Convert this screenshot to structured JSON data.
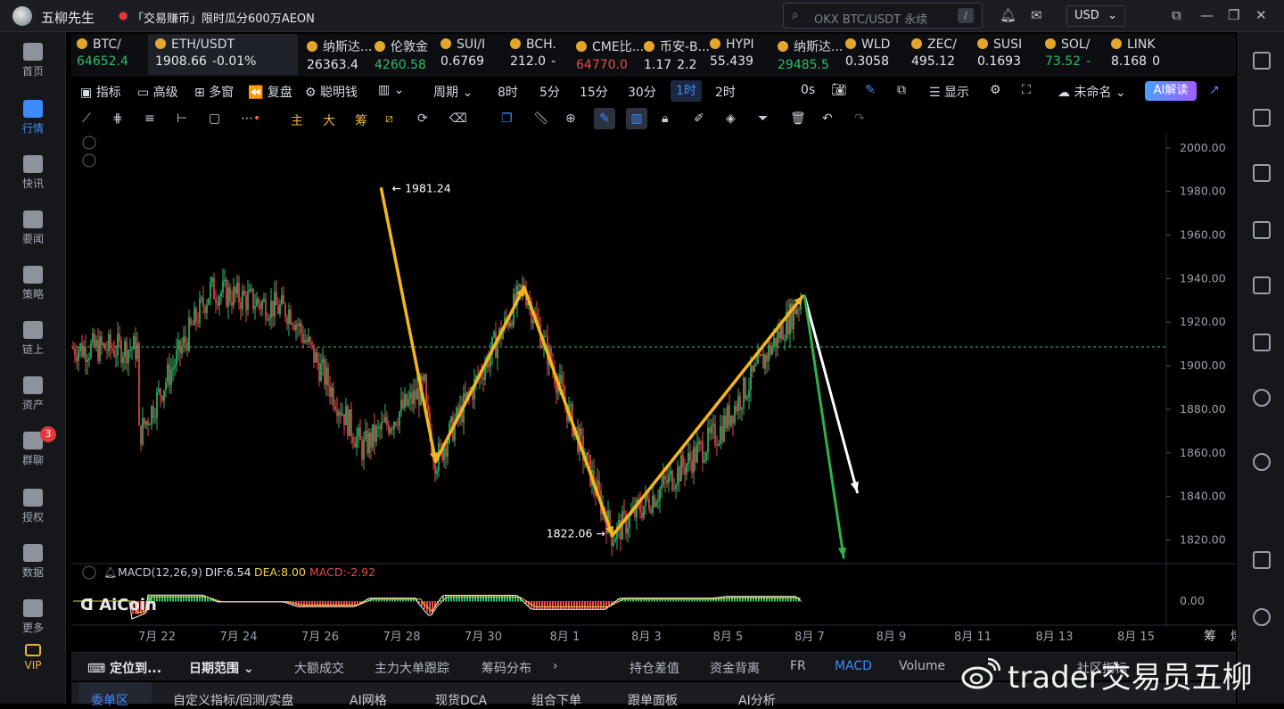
{
  "app": {
    "name": "五柳先生",
    "promo": "「交易赚币」限时瓜分600万AEON"
  },
  "search": {
    "placeholder": "OKX BTC/USDT 永续",
    "shortcut": "/"
  },
  "currency": "USD",
  "sidebar": [
    {
      "label": "首页",
      "icon": "home-icon"
    },
    {
      "label": "行情",
      "icon": "market-icon",
      "active": true
    },
    {
      "label": "快讯",
      "icon": "news-flash-icon"
    },
    {
      "label": "要闻",
      "icon": "headline-icon"
    },
    {
      "label": "策略",
      "icon": "strategy-icon"
    },
    {
      "label": "链上",
      "icon": "onchain-icon"
    },
    {
      "label": "资产",
      "icon": "wallet-icon"
    },
    {
      "label": "群聊",
      "icon": "chat-icon",
      "badge": "3"
    },
    {
      "label": "授权",
      "icon": "key-icon"
    },
    {
      "label": "数据",
      "icon": "data-icon"
    },
    {
      "label": "更多",
      "icon": "more-icon"
    },
    {
      "label": "VIP",
      "icon": "vip-icon"
    }
  ],
  "tickers": [
    {
      "name": "BTC/",
      "price": "64652.4",
      "change": "",
      "dir": "up"
    },
    {
      "name": "ETH/USDT",
      "price": "1908.66",
      "change": "-0.01%",
      "dir": "w",
      "active": true
    },
    {
      "name": "纳斯达...",
      "price": "26363.4",
      "change": "",
      "dir": "w"
    },
    {
      "name": "伦敦金",
      "price": "4260.58",
      "change": "",
      "dir": "up"
    },
    {
      "name": "SUI/I",
      "price": "0.6769",
      "change": "",
      "dir": "w"
    },
    {
      "name": "BCH.",
      "price": "212.0",
      "change": "-",
      "dir": "w"
    },
    {
      "name": "CME比...",
      "price": "64770.0",
      "change": "",
      "dir": "down"
    },
    {
      "name": "币安-B...",
      "price": "1.17",
      "change": "2.2",
      "dir": "w"
    },
    {
      "name": "HYPI",
      "price": "55.439",
      "change": "",
      "dir": "w"
    },
    {
      "name": "纳斯达...",
      "price": "29485.5",
      "change": "",
      "dir": "up"
    },
    {
      "name": "WLD",
      "price": "0.3058",
      "change": "",
      "dir": "w"
    },
    {
      "name": "ZEC/",
      "price": "495.12",
      "change": "",
      "dir": "w"
    },
    {
      "name": "SUSI",
      "price": "0.1693",
      "change": "",
      "dir": "w"
    },
    {
      "name": "SOL/",
      "price": "73.52",
      "change": "-",
      "dir": "up"
    },
    {
      "name": "LINK",
      "price": "8.168",
      "change": "0",
      "dir": "w"
    }
  ],
  "toolbar": {
    "indicators": "指标",
    "advanced": "高级",
    "multi": "多窗",
    "replay": "复盘",
    "smart_money": "聪明钱",
    "period": "周期",
    "intervals": [
      "8时",
      "5分",
      "15分",
      "30分",
      "1时",
      "2时"
    ],
    "selected_interval": "1时",
    "countdown": "0s",
    "display": "显示",
    "layout_name": "未命名",
    "ai": "AI解读"
  },
  "toolbar2": {
    "main": "主",
    "big": "大",
    "chips": "筹"
  },
  "chart_data": {
    "type": "candlestick",
    "symbol": "ETH/USDT",
    "interval": "1h",
    "ylim": [
      1810,
      2004
    ],
    "yticks": [
      "2000.00",
      "1980.00",
      "1960.00",
      "1940.00",
      "1920.00",
      "1900.00",
      "1880.00",
      "1860.00",
      "1840.00",
      "1820.00"
    ],
    "xticks": [
      "7月 22",
      "7月 24",
      "7月 26",
      "7月 28",
      "7月 30",
      "8月 1",
      "8月 3",
      "8月 5",
      "8月 7",
      "8月 9",
      "8月 11",
      "8月 13",
      "8月 15"
    ],
    "last_price": 1908.66,
    "high_label": "1981.24",
    "low_label": "1822.06",
    "swing_points": [
      {
        "date": "7月 27 12:00",
        "price": 1981.24
      },
      {
        "date": "7月 28 20:00",
        "price": 1856
      },
      {
        "date": "7月 31 00:00",
        "price": 1936
      },
      {
        "date": "8月 2 04:00",
        "price": 1822.06
      },
      {
        "date": "8月 6 20:00",
        "price": 1932
      }
    ],
    "projections": [
      {
        "color": "#ffffff",
        "from_price": 1932,
        "to_price": 1842,
        "to_date": "8月 8 04:00"
      },
      {
        "color": "#2fb24a",
        "from_price": 1932,
        "to_price": 1812,
        "to_date": "8月 7 20:00"
      }
    ],
    "macd": {
      "label": "MACD(12,26,9)",
      "dif": "DIF:6.54",
      "dea": "DEA:8.00",
      "macd": "MACD:-2.92",
      "zero_tick": "0.00"
    }
  },
  "corner_labels": [
    "筹",
    "爆"
  ],
  "bottombar": {
    "locate": "定位到...",
    "range": "日期范围",
    "items": [
      "大额成交",
      "主力大单跟踪",
      "筹码分布"
    ],
    "right_items": [
      "持仓差值",
      "资金背离",
      "FR",
      "MACD",
      "Volume"
    ],
    "active": "MACD",
    "community": "社区指标"
  },
  "tabs": [
    "委单区",
    "自定义指标/回测/实盘",
    "AI网格",
    "现货DCA",
    "组合下单",
    "跟单面板",
    "AI分析"
  ],
  "watermark": "trader交易员五柳",
  "colors": {
    "up": "#2ebd6b",
    "down": "#e84a4a",
    "accent": "#3d8bff",
    "arrow": "#f5b51e"
  }
}
